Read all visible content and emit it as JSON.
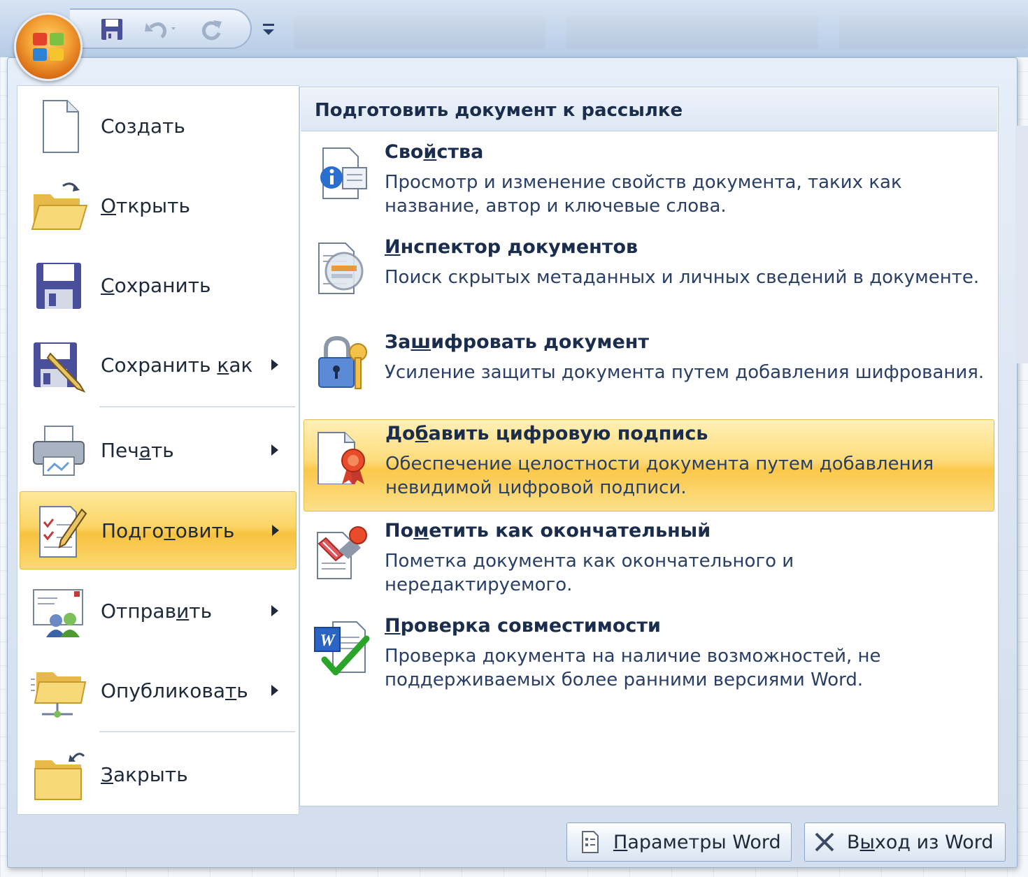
{
  "window": {
    "quick_access_icons": [
      "save-icon",
      "undo-icon",
      "redo-icon",
      "customize-qat-icon"
    ]
  },
  "left_menu": {
    "items": [
      {
        "label_pre": "Соз",
        "key": "д",
        "label_post": "ать",
        "has_submenu": false,
        "icon": "new-document-icon"
      },
      {
        "label_pre": "",
        "key": "О",
        "label_post": "ткрыть",
        "has_submenu": false,
        "icon": "open-folder-icon"
      },
      {
        "label_pre": "",
        "key": "С",
        "label_post": "охранить",
        "has_submenu": false,
        "icon": "save-icon"
      },
      {
        "label_pre": "Сохранить ",
        "key": "к",
        "label_post": "ак",
        "has_submenu": true,
        "icon": "save-as-icon"
      },
      {
        "label_pre": "Печ",
        "key": "а",
        "label_post": "ть",
        "has_submenu": true,
        "icon": "printer-icon"
      },
      {
        "label_pre": "Подго",
        "key": "т",
        "label_post": "овить",
        "has_submenu": true,
        "active": true,
        "icon": "prepare-icon"
      },
      {
        "label_pre": "Отправ",
        "key": "и",
        "label_post": "ть",
        "has_submenu": true,
        "icon": "send-icon"
      },
      {
        "label_pre": "Опубликова",
        "key": "т",
        "label_post": "ь",
        "has_submenu": true,
        "icon": "publish-icon"
      },
      {
        "label_pre": "",
        "key": "З",
        "label_post": "акрыть",
        "has_submenu": false,
        "icon": "close-folder-icon"
      }
    ]
  },
  "submenu": {
    "header": "Подготовить документ к рассылке",
    "items": [
      {
        "title_pre": "Сво",
        "key": "й",
        "title_post": "ства",
        "desc": "Просмотр и изменение свойств документа, таких как название, автор и ключевые слова.",
        "icon": "properties-icon"
      },
      {
        "title_pre": "",
        "key": "И",
        "title_post": "нспектор документов",
        "desc": "Поиск скрытых метаданных и личных сведений в документе.",
        "icon": "inspector-icon"
      },
      {
        "title_pre": "За",
        "key": "ш",
        "title_post": "ифровать документ",
        "desc": "Усиление защиты документа путем добавления шифрования.",
        "icon": "encrypt-icon"
      },
      {
        "title_pre": "До",
        "key": "б",
        "title_post": "авить цифровую подпись",
        "desc": "Обеспечение целостности документа путем добавления невидимой цифровой подписи.",
        "icon": "signature-icon",
        "highlighted": true
      },
      {
        "title_pre": "По",
        "key": "м",
        "title_post": "етить как окончательный",
        "desc": "Пометка документа как окончательного и нередактируемого.",
        "icon": "mark-final-icon"
      },
      {
        "title_pre": "",
        "key": "П",
        "title_post": "роверка совместимости",
        "desc": "Проверка документа на наличие возможностей, не поддерживаемых более ранними версиями Word.",
        "icon": "compatibility-icon"
      }
    ]
  },
  "footer": {
    "options_pre": "",
    "options_key": "П",
    "options_post": "араметры Word",
    "exit_pre": "В",
    "exit_key": "ы",
    "exit_post": "ход из Word"
  },
  "colors": {
    "highlight": "#fbc84a",
    "accent_text": "#1b2d4d"
  }
}
